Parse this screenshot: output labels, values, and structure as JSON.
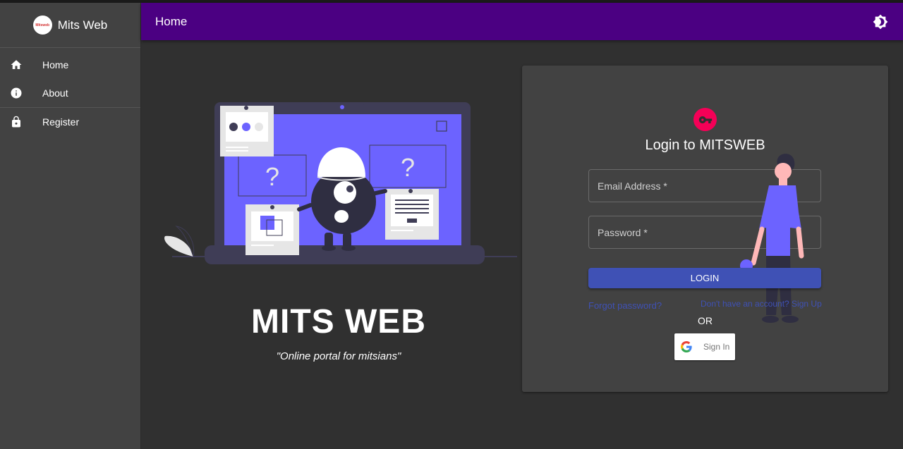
{
  "sidebar": {
    "brand_logo_text": "Mitsweb",
    "brand_name": "Mits Web",
    "items": [
      {
        "label": "Home",
        "icon": "home-icon"
      },
      {
        "label": "About",
        "icon": "info-icon"
      },
      {
        "label": "Register",
        "icon": "lock-icon"
      }
    ]
  },
  "appbar": {
    "title": "Home",
    "theme_icon": "brightness-icon"
  },
  "hero": {
    "title": "MITS WEB",
    "subtitle": "\"Online portal for mitsians\""
  },
  "login": {
    "avatar_icon": "key-icon",
    "title": "Login to MITSWEB",
    "email_label": "Email Address *",
    "password_label": "Password *",
    "login_button": "LOGIN",
    "forgot_link": "Forgot password?",
    "signup_link": "Don't have an account? Sign Up",
    "or_text": "OR",
    "google_button": "Sign In"
  },
  "colors": {
    "appbar": "#4b0082",
    "sidebar": "#424242",
    "background": "#303030",
    "card": "#424242",
    "primary": "#3f51b5",
    "accent": "#f50057",
    "illustration": "#6c63ff"
  }
}
